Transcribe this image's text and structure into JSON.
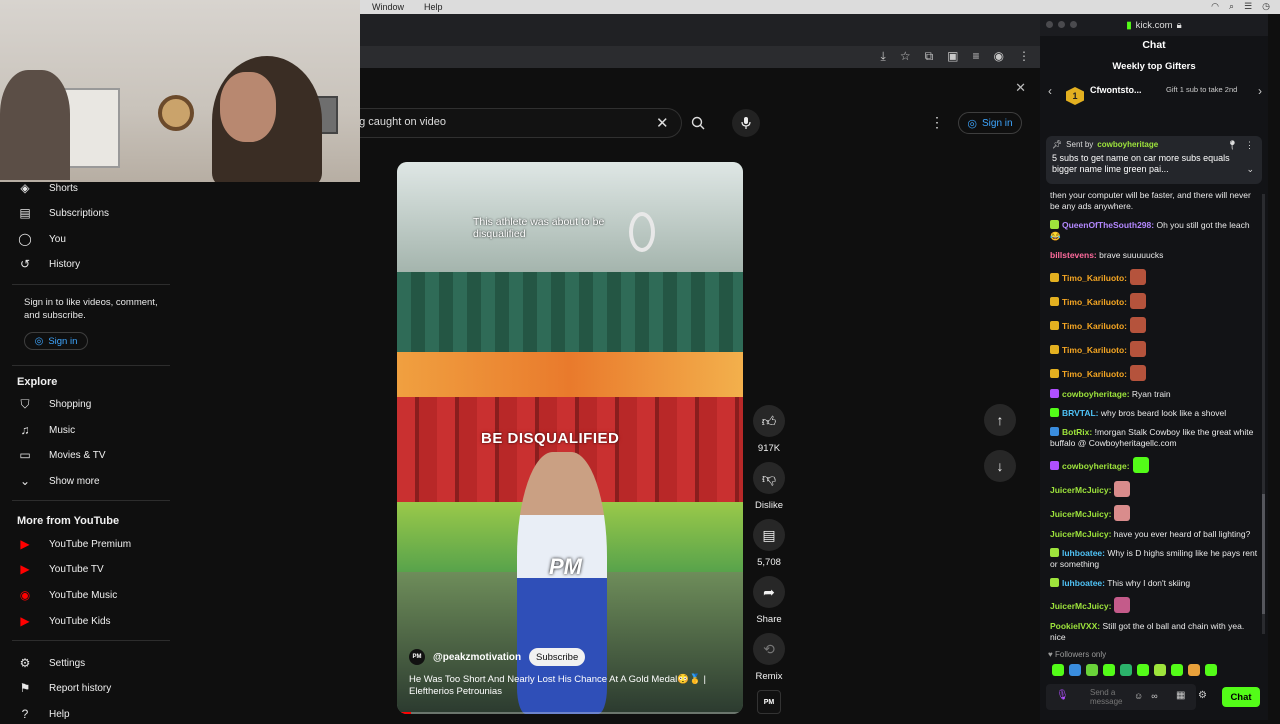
{
  "menubar": {
    "items": [
      "Window",
      "Help"
    ]
  },
  "search": {
    "query": "ng caught on video",
    "clear_icon": "close-icon",
    "search_icon": "search-icon",
    "mic_icon": "mic-icon"
  },
  "header": {
    "signin_label": "Sign in"
  },
  "sidebar": {
    "items": [
      {
        "label": "Shorts",
        "icon": "shorts-icon"
      },
      {
        "label": "Subscriptions",
        "icon": "subscriptions-icon"
      },
      {
        "label": "You",
        "icon": "you-icon"
      },
      {
        "label": "History",
        "icon": "history-icon"
      }
    ],
    "signin_prompt": "Sign in to like videos, comment, and subscribe.",
    "signin_label": "Sign in",
    "explore_heading": "Explore",
    "explore": [
      {
        "label": "Shopping",
        "icon": "shopping-icon"
      },
      {
        "label": "Music",
        "icon": "music-icon"
      },
      {
        "label": "Movies & TV",
        "icon": "movies-icon"
      },
      {
        "label": "Show more",
        "icon": "chevron-down-icon"
      }
    ],
    "more_heading": "More from YouTube",
    "more": [
      {
        "label": "YouTube Premium",
        "color": "#ff0000"
      },
      {
        "label": "YouTube TV",
        "color": "#ff0000"
      },
      {
        "label": "YouTube Music",
        "color": "#ff0000"
      },
      {
        "label": "YouTube Kids",
        "color": "#ff0000"
      }
    ],
    "bottom": [
      {
        "label": "Settings",
        "icon": "gear-icon"
      },
      {
        "label": "Report history",
        "icon": "flag-icon"
      },
      {
        "label": "Help",
        "icon": "help-icon"
      }
    ]
  },
  "video": {
    "caption_top": "This athlete was about to be disqualified",
    "caption_big": "BE DISQUALIFIED",
    "watermark": "PM",
    "channel": "@peakzmotivation",
    "channel_avatar": "PM",
    "subscribe_label": "Subscribe",
    "title": "He Was Too Short And Nearly Lost His Chance At A Gold Medal😳🥇 | Eleftherios Petrounias",
    "progress": 0.04
  },
  "actions": {
    "like_count": "917K",
    "dislike_label": "Dislike",
    "comments_count": "5,708",
    "share_label": "Share",
    "remix_label": "Remix",
    "remix_thumb": "PM"
  },
  "kick": {
    "domain": "kick.com",
    "chat_title": "Chat",
    "gifters_title": "Weekly top Gifters",
    "top_gifter": "Cfwontsto...",
    "top_gifter_rank": "1",
    "gift_cta": "Gift 1 sub to take 2nd",
    "pinned": {
      "sent_by": "Sent by",
      "user": "cowboyheritage",
      "message": "5 subs to get name on car more subs equals bigger name lime green pai..."
    },
    "messages": [
      {
        "user": "",
        "color": "#eaeaea",
        "text": "then your computer will be faster, and there will never be any ads anywhere.",
        "badge": ""
      },
      {
        "user": "QueenOfTheSouth298:",
        "color": "#b388ff",
        "text": "Oh you still got the leach 😂",
        "badge": "#9ee43c"
      },
      {
        "user": "billstevens:",
        "color": "#ff6b9d",
        "text": "brave suuuuucks",
        "badge": ""
      },
      {
        "user": "Timo_Kariluoto:",
        "color": "#f5a623",
        "text": "",
        "badge": "#e3b020",
        "emote": "#b5533c"
      },
      {
        "user": "Timo_Kariluoto:",
        "color": "#f5a623",
        "text": "",
        "badge": "#e3b020",
        "emote": "#b5533c"
      },
      {
        "user": "Timo_Kariluoto:",
        "color": "#f5a623",
        "text": "",
        "badge": "#e3b020",
        "emote": "#b5533c"
      },
      {
        "user": "Timo_Kariluoto:",
        "color": "#f5a623",
        "text": "",
        "badge": "#e3b020",
        "emote": "#b5533c"
      },
      {
        "user": "Timo_Kariluoto:",
        "color": "#f5a623",
        "text": "",
        "badge": "#e3b020",
        "emote": "#b5533c"
      },
      {
        "user": "cowboyheritage:",
        "color": "#9ee43c",
        "text": "Ryan train",
        "badge": "#b050ff"
      },
      {
        "user": "BRVTAL:",
        "color": "#4fc3f7",
        "text": "why bros beard look like a shovel",
        "badge": "#53fc18"
      },
      {
        "user": "BotRix:",
        "color": "#9ee43c",
        "text": "!morgan Stalk Cowboy like the great white buffalo @ Cowboyheritagellc.com",
        "badge": "#3a8dde"
      },
      {
        "user": "cowboyheritage:",
        "color": "#9ee43c",
        "text": "",
        "badge": "#b050ff",
        "emote": "#53fc18"
      },
      {
        "user": "JuicerMcJuicy:",
        "color": "#9ee43c",
        "text": "",
        "badge": "",
        "emote": "#d98c8c"
      },
      {
        "user": "JuicerMcJuicy:",
        "color": "#9ee43c",
        "text": "",
        "badge": "",
        "emote": "#d98c8c"
      },
      {
        "user": "JuicerMcJuicy:",
        "color": "#9ee43c",
        "text": "have you ever heard of ball lighting?",
        "badge": ""
      },
      {
        "user": "luhboatee:",
        "color": "#4fc3f7",
        "text": "Why is D highs smiling like he pays rent or something",
        "badge": "#9ee43c"
      },
      {
        "user": "luhboatee:",
        "color": "#4fc3f7",
        "text": "This why I don't skiing",
        "badge": "#9ee43c"
      },
      {
        "user": "JuicerMcJuicy:",
        "color": "#9ee43c",
        "text": "",
        "badge": "",
        "emote": "#c45b8a"
      },
      {
        "user": "PookieIVXX:",
        "color": "#9ee43c",
        "text": "Still got the ol ball and chain with yea. nice",
        "badge": ""
      }
    ],
    "followers_only": "Followers only",
    "send_placeholder": "Send a message",
    "chat_button": "Chat",
    "accent": "#53fc18"
  }
}
